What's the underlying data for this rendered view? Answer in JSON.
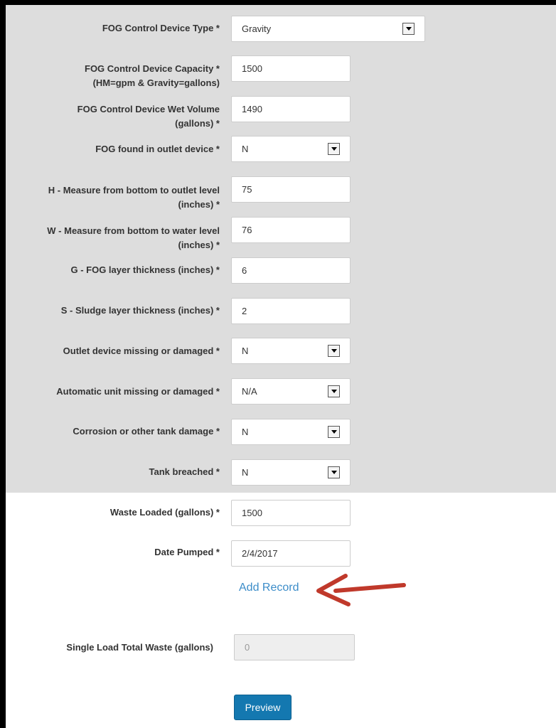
{
  "form": {
    "device_type": {
      "label": "FOG Control Device Type *",
      "value": "Gravity"
    },
    "capacity": {
      "label_line1": "FOG Control Device Capacity *",
      "label_line2": "(HM=gpm & Gravity=gallons)",
      "value": "1500"
    },
    "wet_volume": {
      "label_line1": "FOG Control Device Wet Volume",
      "label_line2": "(gallons) *",
      "value": "1490"
    },
    "fog_found_outlet": {
      "label": "FOG found in outlet device *",
      "value": "N"
    },
    "h_measure": {
      "label_line1": "H - Measure from bottom to outlet level",
      "label_line2": "(inches) *",
      "value": "75"
    },
    "w_measure": {
      "label_line1": "W - Measure from bottom to water level",
      "label_line2": "(inches) *",
      "value": "76"
    },
    "g_fog_layer": {
      "label": "G - FOG layer thickness (inches) *",
      "value": "6"
    },
    "s_sludge_layer": {
      "label": "S - Sludge layer thickness (inches) *",
      "value": "2"
    },
    "outlet_missing": {
      "label": "Outlet device missing or damaged *",
      "value": "N"
    },
    "automatic_unit_missing": {
      "label": "Automatic unit missing or damaged *",
      "value": "N/A"
    },
    "corrosion": {
      "label": "Corrosion or other tank damage *",
      "value": "N"
    },
    "tank_breached": {
      "label": "Tank breached *",
      "value": "N"
    },
    "waste_loaded": {
      "label": "Waste Loaded (gallons) *",
      "value": "1500"
    },
    "date_pumped": {
      "label": "Date Pumped *",
      "value": "2/4/2017"
    },
    "add_record_label": "Add Record"
  },
  "summary": {
    "total_waste_label": "Single Load Total Waste (gallons)",
    "total_waste_value": "0",
    "preview_label": "Preview"
  },
  "annotation": {
    "arrow_color": "#c0392b"
  },
  "colors": {
    "panel_bg": "#dddddd",
    "link": "#3c8dc9",
    "button": "#1478b0"
  }
}
